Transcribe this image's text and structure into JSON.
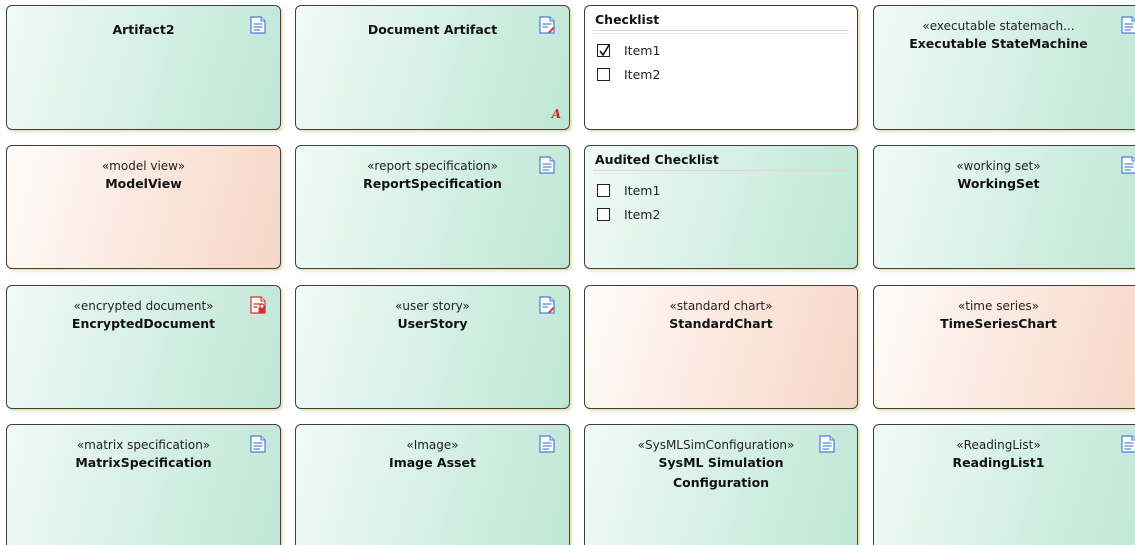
{
  "elements": [
    {
      "stereotype": "",
      "name": "Artifact2",
      "icon": "document-icon"
    },
    {
      "stereotype": "",
      "name": "Document Artifact",
      "icon": "document-artifact-icon",
      "corner_mark": "A"
    },
    {
      "type": "checklist",
      "header": "Checklist",
      "items": [
        {
          "label": "Item1",
          "checked": true
        },
        {
          "label": "Item2",
          "checked": false
        }
      ]
    },
    {
      "stereotype": "«executable statemach...",
      "name": "Executable StateMachine",
      "icon": "document-icon"
    },
    {
      "stereotype": "«model view»",
      "name": "ModelView"
    },
    {
      "stereotype": "«report specification»",
      "name": "ReportSpecification",
      "icon": "document-icon"
    },
    {
      "type": "checklist",
      "header": "Audited Checklist",
      "items": [
        {
          "label": "Item1",
          "checked": false
        },
        {
          "label": "Item2",
          "checked": false
        }
      ]
    },
    {
      "stereotype": "«working set»",
      "name": "WorkingSet",
      "icon": "document-icon"
    },
    {
      "stereotype": "«encrypted document»",
      "name": "EncryptedDocument",
      "icon": "encrypted-document-icon"
    },
    {
      "stereotype": "«user story»",
      "name": "UserStory",
      "icon": "document-artifact-icon"
    },
    {
      "stereotype": "«standard chart»",
      "name": "StandardChart"
    },
    {
      "stereotype": "«time series»",
      "name": "TimeSeriesChart"
    },
    {
      "stereotype": "«matrix specification»",
      "name": "MatrixSpecification",
      "icon": "document-icon"
    },
    {
      "stereotype": "«Image»",
      "name": "Image Asset",
      "icon": "document-icon"
    },
    {
      "stereotype": "«SysMLSimConfiguration»",
      "name": "SysML Simulation Configuration",
      "icon": "document-icon"
    },
    {
      "stereotype": "«ReadingList»",
      "name": "ReadingList1",
      "icon": "document-icon"
    }
  ],
  "colors": {
    "element_green": "#d6f0e6",
    "element_peach": "#fbe6dc",
    "border": "#3f3f3f",
    "icon_blue": "#5b8fd6",
    "encrypted_red": "#d83030",
    "corner_mark_red": "#e02020"
  }
}
